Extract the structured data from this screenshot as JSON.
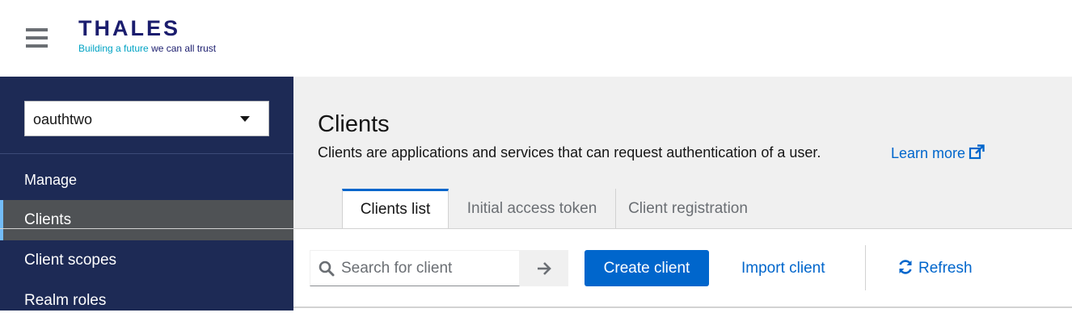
{
  "header": {
    "menu_icon": "hamburger-menu-icon",
    "logo": {
      "wordmark": "THALES",
      "tagline_part1": "Building a future",
      "tagline_part2": "we can all trust"
    }
  },
  "sidebar": {
    "realm_selector": {
      "value": "oauthtwo",
      "icon": "caret-down-icon"
    },
    "section_label": "Manage",
    "items": [
      {
        "label": "Clients",
        "active": true
      },
      {
        "label": "Client scopes",
        "active": false
      },
      {
        "label": "Realm roles",
        "active": false
      }
    ]
  },
  "page": {
    "title": "Clients",
    "description": "Clients are applications and services that can request authentication of a user.",
    "learn_more": "Learn more",
    "learn_more_icon": "external-link-icon"
  },
  "tabs": [
    {
      "label": "Clients list",
      "active": true
    },
    {
      "label": "Initial access token",
      "active": false
    },
    {
      "label": "Client registration",
      "active": false
    }
  ],
  "toolbar": {
    "search_placeholder": "Search for client",
    "search_icon": "search-icon",
    "search_submit_icon": "arrow-right-icon",
    "create_label": "Create client",
    "import_label": "Import client",
    "refresh_label": "Refresh",
    "refresh_icon": "sync-icon"
  },
  "colors": {
    "sidebar_bg": "#1d2a55",
    "active_item_bg": "#4f5255",
    "primary": "#0066cc",
    "brand_navy": "#1b1d6e",
    "brand_cyan": "#00a3c4"
  }
}
